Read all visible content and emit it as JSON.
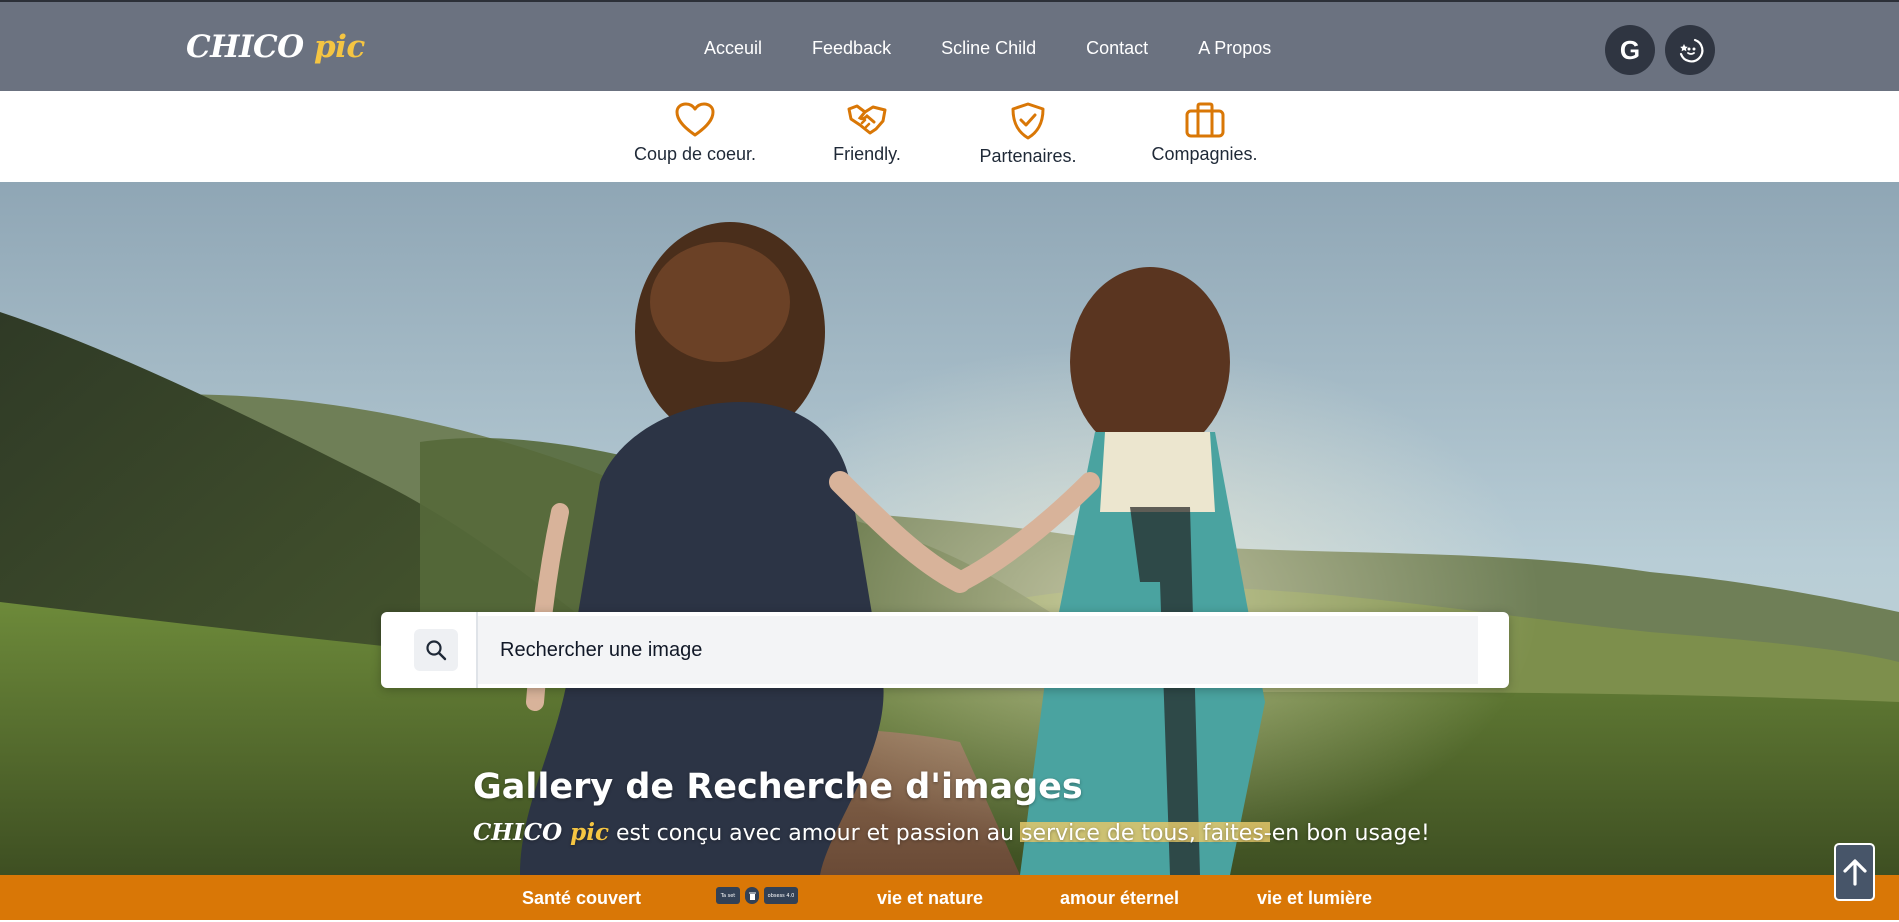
{
  "brand": {
    "name": "CHICO",
    "accent": "pic"
  },
  "nav": {
    "links": [
      "Acceuil",
      "Feedback",
      "Scline Child",
      "Contact",
      "A Propos"
    ]
  },
  "header_buttons": [
    {
      "icon": "google-icon",
      "label": "G"
    },
    {
      "icon": "theme-moon-icon"
    }
  ],
  "categories": [
    {
      "icon": "heart-icon",
      "label": "Coup de coeur."
    },
    {
      "icon": "handshake-icon",
      "label": "Friendly."
    },
    {
      "icon": "shield-check-icon",
      "label": "Partenaires."
    },
    {
      "icon": "briefcase-icon",
      "label": "Compagnies."
    }
  ],
  "search": {
    "placeholder": "Rechercher une image",
    "value": ""
  },
  "hero": {
    "title": "Gallery de Recherche d'images",
    "tagline_brand": "CHICO",
    "tagline_brand_accent": "pic",
    "tagline_text": " est conçu avec amour et passion au service de tous, faites-en bon usage!"
  },
  "strip": {
    "items": [
      "Santé couvert",
      "vie et nature",
      "amour éternel",
      "vie et lumière"
    ],
    "mini_badges": [
      "Ta set",
      "obsess 4.0"
    ]
  },
  "colors": {
    "navbar": "#6b7280",
    "accent_gold": "#f5c542",
    "category_icon": "#d97706",
    "strip": "#d97706",
    "dark_button": "#2f3541"
  }
}
